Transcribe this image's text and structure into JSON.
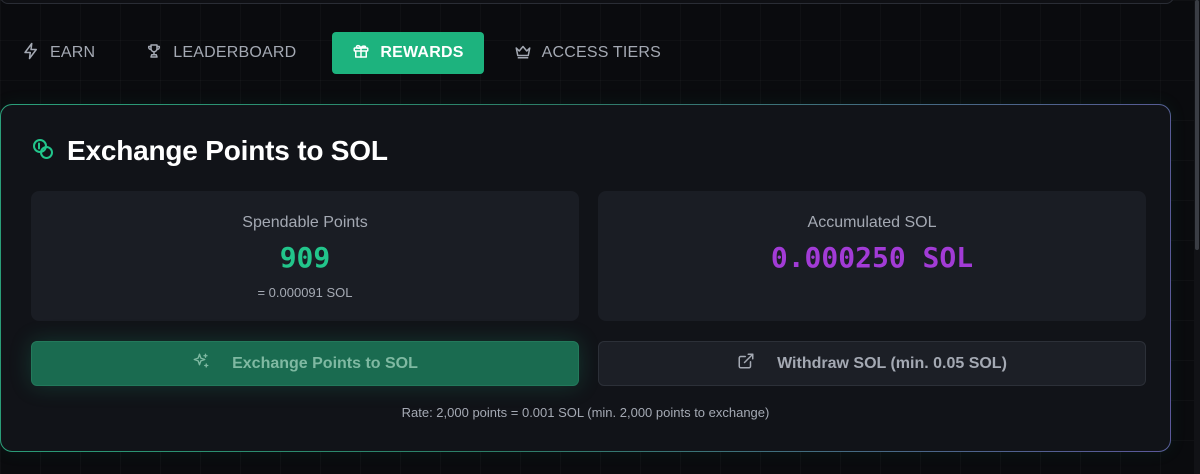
{
  "tabs": [
    {
      "label": "EARN",
      "icon": "lightning-icon",
      "active": false
    },
    {
      "label": "LEADERBOARD",
      "icon": "trophy-icon",
      "active": false
    },
    {
      "label": "REWARDS",
      "icon": "gift-icon",
      "active": true
    },
    {
      "label": "ACCESS TIERS",
      "icon": "crown-icon",
      "active": false
    }
  ],
  "card": {
    "title": "Exchange Points to SOL",
    "icon": "coins-icon",
    "spendable": {
      "label": "Spendable Points",
      "value": "909",
      "sub": "= 0.000091 SOL"
    },
    "accumulated": {
      "label": "Accumulated SOL",
      "value": "0.000250 SOL"
    },
    "exchange_button": {
      "label": "Exchange Points to SOL",
      "icon": "sparkles-icon"
    },
    "withdraw_button": {
      "label": "Withdraw SOL (min. 0.05 SOL)",
      "icon": "external-link-icon"
    },
    "rate_note": "Rate: 2,000 points = 0.001 SOL (min. 2,000 points to exchange)"
  },
  "colors": {
    "accent_green": "#1db37e",
    "points_green": "#22c58b",
    "sol_purple": "#a23bd6",
    "card_bg": "#111318"
  }
}
